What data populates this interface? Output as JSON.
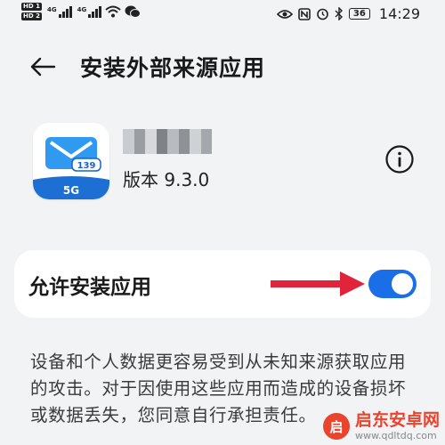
{
  "status_bar": {
    "sim1": "HD 1",
    "sim2": "HD 2",
    "network_1": "4G",
    "network_2": "4G",
    "battery": "36",
    "time": "14:29"
  },
  "header": {
    "title": "安装外部来源应用"
  },
  "app": {
    "version": "版本 9.3.0",
    "icon_badge_number": "139",
    "icon_badge_network": "5G"
  },
  "setting": {
    "label": "允许安装应用",
    "enabled": true
  },
  "warning_text": "设备和个人数据更容易受到从未知来源获取应用的攻击。对于因使用这些应用而造成的设备损坏或数据丢失，您同意自行承担责任。",
  "watermark": {
    "name": "启东安卓网",
    "url": "www.qdltdq.com"
  },
  "colors": {
    "accent": "#1a6fe8",
    "arrow": "#e0243b",
    "background": "#f1f3f5"
  }
}
